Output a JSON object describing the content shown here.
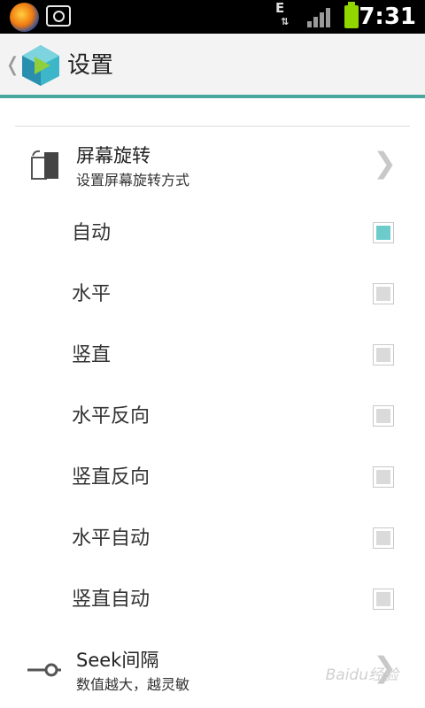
{
  "status_bar": {
    "network_type": "E",
    "network_arrows": "⇅",
    "time": "7:31",
    "icons": [
      "app-notification-icon",
      "camera-icon",
      "signal-icon",
      "battery-icon"
    ]
  },
  "action_bar": {
    "back_glyph": "❬",
    "title": "设置"
  },
  "screen_rotation": {
    "title": "屏幕旋转",
    "subtitle": "设置屏幕旋转方式",
    "chevron": "❯",
    "options": [
      {
        "label": "自动",
        "checked": true
      },
      {
        "label": "水平",
        "checked": false
      },
      {
        "label": "竖直",
        "checked": false
      },
      {
        "label": "水平反向",
        "checked": false
      },
      {
        "label": "竖直反向",
        "checked": false
      },
      {
        "label": "水平自动",
        "checked": false
      },
      {
        "label": "竖直自动",
        "checked": false
      }
    ]
  },
  "seek_interval": {
    "title": "Seek间隔",
    "subtitle": "数值越大，越灵敏",
    "chevron": "❯"
  },
  "watermark": "Baidu经验",
  "colors": {
    "accent": "#48a8a0",
    "checked": "#6ccccc",
    "battery": "#92d600"
  }
}
